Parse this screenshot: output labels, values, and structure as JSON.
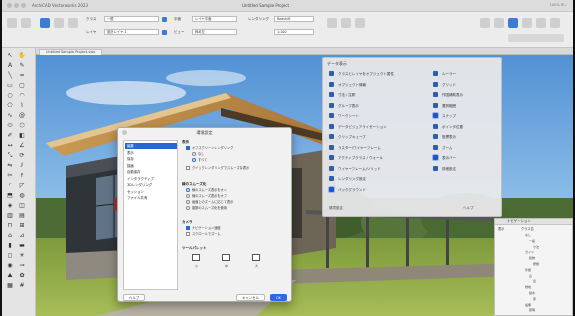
{
  "window": {
    "app_title": "ArchiCAD Vectorworks 2023",
    "doc_title": "Untitled Sample Project",
    "status": "100% ☰ ⌕"
  },
  "ribbon": {
    "class_label": "クラス",
    "class_value": "一般",
    "layer_label": "レイヤ",
    "layer_value": "設計レイヤ-1",
    "plane_label": "平面",
    "plane_value": "レイヤ平面",
    "view_label": "ビュー",
    "view_value": "斜め左",
    "render_label": "レンダリング",
    "render_value": "Redshift",
    "scale_value": "1:100",
    "colors": {
      "accent": "#3d7bd9",
      "toolbar_bg": "#ececec"
    }
  },
  "viewport": {
    "tab_label": "Untitled Sample Project.vwx"
  },
  "attributes": {
    "title": "データ表示",
    "items_left": [
      "クラスとレイヤをオブジェクト属性",
      "オブジェクト情報",
      "寸法 / 注釈",
      "グループ表示",
      "ワークシート",
      "データビジュアライゼーション",
      "クリップキューブ",
      "ラスター/ワイヤーフレーム",
      "アクティブクラス / ウォール",
      "ワイヤーフレーム/ソリッド",
      "レンダリング設定",
      "バックグラウンド"
    ],
    "items_right": [
      "ルーラー",
      "グリッド",
      "作図補助表示",
      "選択範囲",
      "スナップ",
      "ポインタ位置",
      "座標表示",
      "ズーム",
      "表示バー",
      "詳細設定"
    ],
    "footer_left": "環境設定",
    "footer_right": "ヘルプ"
  },
  "dialog": {
    "title": "環境設定",
    "categories": [
      "編集",
      "表示",
      "保存",
      "描画",
      "自動保存",
      "インタラクティブ",
      "3Dレンダリング",
      "セッション",
      "ファイル共有"
    ],
    "selected_index": 0,
    "section1_title": "表示",
    "section1_options": [
      "オフスクリーンレンダリング",
      "なし",
      "すべて",
      "クイックレンダリングでスムーズな表示"
    ],
    "section2_title": "線のスムーズ化",
    "section2_options": [
      "線のスムーズ表示をオン",
      "線のスムーズ表示をオフ",
      "画面上のズームに応じて表示",
      "複数のスムーズ化を使用"
    ],
    "section3_title": "カメラ",
    "section3_options": [
      "ナビゲーション速度",
      "スクロールでズーム"
    ],
    "section4_title": "ツールパレット",
    "icon_labels": [
      "小",
      "中",
      "大"
    ],
    "btn_left": "ヘルプ",
    "btn_cancel": "キャンセル",
    "btn_ok": "OK"
  },
  "navigation": {
    "title": "ナビゲーション",
    "col1": "表示",
    "col2": "クラス名",
    "rows": [
      "なし",
      "一般",
      "寸法",
      "ガイド",
      "建物",
      "屋根",
      "外壁",
      "窓",
      "扉",
      "敷地",
      "樹木",
      "床",
      "設備",
      "照明"
    ]
  }
}
